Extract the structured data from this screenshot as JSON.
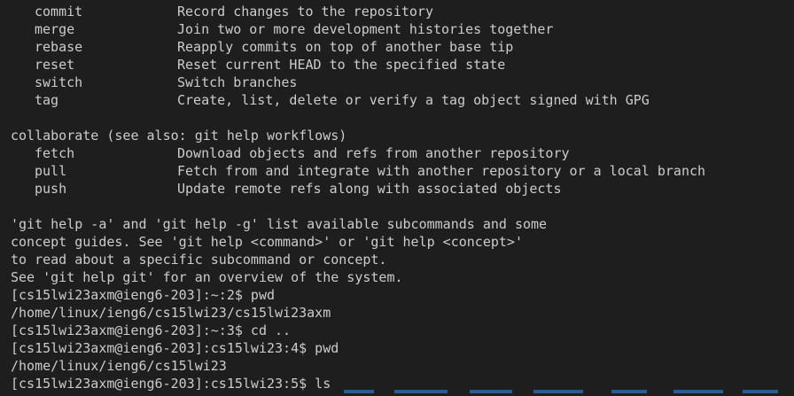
{
  "theme": {
    "background": "#1e1e1e",
    "foreground": "#cccccc",
    "ls_color": "#3b8eea"
  },
  "group1": {
    "commands": [
      {
        "name": "commit",
        "desc": "Record changes to the repository"
      },
      {
        "name": "merge",
        "desc": "Join two or more development histories together"
      },
      {
        "name": "rebase",
        "desc": "Reapply commits on top of another base tip"
      },
      {
        "name": "reset",
        "desc": "Reset current HEAD to the specified state"
      },
      {
        "name": "switch",
        "desc": "Switch branches"
      },
      {
        "name": "tag",
        "desc": "Create, list, delete or verify a tag object signed with GPG"
      }
    ]
  },
  "group2": {
    "heading": "collaborate (see also: git help workflows)",
    "commands": [
      {
        "name": "fetch",
        "desc": "Download objects and refs from another repository"
      },
      {
        "name": "pull",
        "desc": "Fetch from and integrate with another repository or a local branch"
      },
      {
        "name": "push",
        "desc": "Update remote refs along with associated objects"
      }
    ]
  },
  "footer": {
    "lines": [
      "'git help -a' and 'git help -g' list available subcommands and some",
      "concept guides. See 'git help <command>' or 'git help <concept>'",
      "to read about a specific subcommand or concept.",
      "See 'git help git' for an overview of the system."
    ]
  },
  "session": {
    "lines": [
      "[cs15lwi23axm@ieng6-203]:~:2$ pwd",
      "/home/linux/ieng6/cs15lwi23/cs15lwi23axm",
      "[cs15lwi23axm@ieng6-203]:~:3$ cd ..",
      "[cs15lwi23axm@ieng6-203]:cs15lwi23:4$ pwd",
      "/home/linux/ieng6/cs15lwi23",
      "[cs15lwi23axm@ieng6-203]:cs15lwi23:5$ ls"
    ]
  }
}
